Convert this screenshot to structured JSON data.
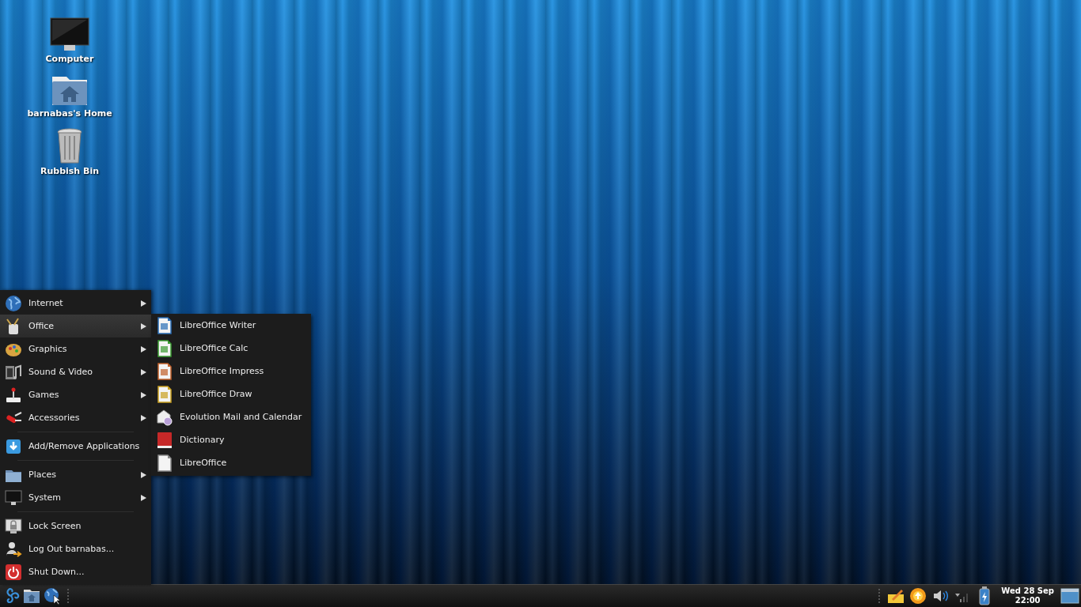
{
  "desktop_icons": [
    {
      "label": "Computer",
      "kind": "computer"
    },
    {
      "label": "barnabas's Home",
      "kind": "home"
    },
    {
      "label": "Rubbish Bin",
      "kind": "trash"
    }
  ],
  "menu": {
    "groups": [
      [
        {
          "label": "Internet",
          "kind": "globe",
          "has_submenu": true,
          "selected": false
        },
        {
          "label": "Office",
          "kind": "office",
          "has_submenu": true,
          "selected": true
        },
        {
          "label": "Graphics",
          "kind": "graphics",
          "has_submenu": true,
          "selected": false
        },
        {
          "label": "Sound & Video",
          "kind": "media",
          "has_submenu": true,
          "selected": false
        },
        {
          "label": "Games",
          "kind": "games",
          "has_submenu": true,
          "selected": false
        },
        {
          "label": "Accessories",
          "kind": "accessories",
          "has_submenu": true,
          "selected": false
        }
      ],
      [
        {
          "label": "Add/Remove Applications",
          "kind": "install",
          "has_submenu": false,
          "selected": false
        }
      ],
      [
        {
          "label": "Places",
          "kind": "places",
          "has_submenu": true,
          "selected": false
        },
        {
          "label": "System",
          "kind": "system",
          "has_submenu": true,
          "selected": false
        }
      ],
      [
        {
          "label": "Lock Screen",
          "kind": "lock",
          "has_submenu": false,
          "selected": false
        },
        {
          "label": "Log Out barnabas...",
          "kind": "logout",
          "has_submenu": false,
          "selected": false
        },
        {
          "label": "Shut Down...",
          "kind": "shutdown",
          "has_submenu": false,
          "selected": false
        }
      ]
    ]
  },
  "submenu": {
    "items": [
      {
        "label": "LibreOffice Writer",
        "kind": "writer"
      },
      {
        "label": "LibreOffice Calc",
        "kind": "calc"
      },
      {
        "label": "LibreOffice Impress",
        "kind": "impress"
      },
      {
        "label": "LibreOffice Draw",
        "kind": "draw"
      },
      {
        "label": "Evolution Mail and Calendar",
        "kind": "mail"
      },
      {
        "label": "Dictionary",
        "kind": "dictionary"
      },
      {
        "label": "LibreOffice",
        "kind": "document"
      }
    ]
  },
  "taskbar": {
    "launchers": [
      {
        "kind": "logo"
      },
      {
        "kind": "home"
      },
      {
        "kind": "browser"
      }
    ],
    "tray": [
      {
        "kind": "notes"
      },
      {
        "kind": "update"
      },
      {
        "kind": "volume"
      },
      {
        "kind": "signal"
      },
      {
        "kind": "battery"
      }
    ],
    "date": "Wed 28 Sep",
    "time": "22:00"
  }
}
